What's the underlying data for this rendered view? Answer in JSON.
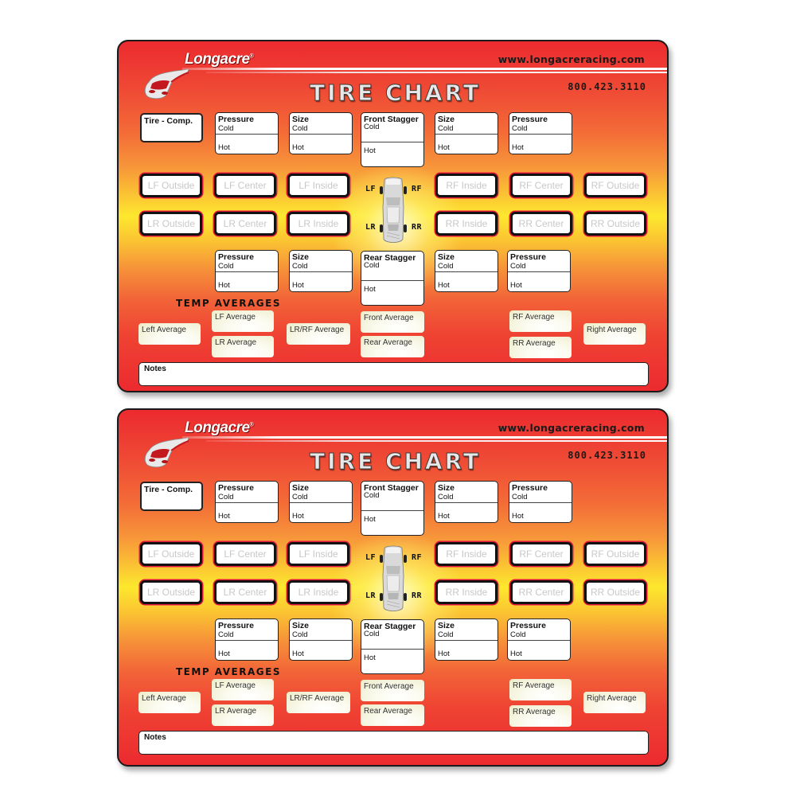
{
  "cards": [
    {
      "brand": "Longacre",
      "registered_mark": "®",
      "website": "www.longacreracing.com",
      "phone": "800.423.3110",
      "title": "TIRE CHART",
      "tire_comp_label": "Tire - Comp.",
      "front_row": {
        "left_pressure": {
          "label": "Pressure",
          "cold": "Cold",
          "hot": "Hot"
        },
        "left_size": {
          "label": "Size",
          "cold": "Cold",
          "hot": "Hot"
        },
        "stagger": {
          "label": "Front Stagger",
          "cold": "Cold",
          "hot": "Hot"
        },
        "right_size": {
          "label": "Size",
          "cold": "Cold",
          "hot": "Hot"
        },
        "right_pressure": {
          "label": "Pressure",
          "cold": "Cold",
          "hot": "Hot"
        }
      },
      "temp_front": [
        "LF Outside",
        "LF Center",
        "LF Inside",
        "RF Inside",
        "RF Center",
        "RF Outside"
      ],
      "temp_rear": [
        "LR Outside",
        "LR Center",
        "LR Inside",
        "RR Inside",
        "RR Center",
        "RR Outside"
      ],
      "wheel_labels": {
        "lf": "LF",
        "rf": "RF",
        "lr": "LR",
        "rr": "RR"
      },
      "rear_row": {
        "left_pressure": {
          "label": "Pressure",
          "cold": "Cold",
          "hot": "Hot"
        },
        "left_size": {
          "label": "Size",
          "cold": "Cold",
          "hot": "Hot"
        },
        "stagger": {
          "label": "Rear Stagger",
          "cold": "Cold",
          "hot": "Hot"
        },
        "right_size": {
          "label": "Size",
          "cold": "Cold",
          "hot": "Hot"
        },
        "right_pressure": {
          "label": "Pressure",
          "cold": "Cold",
          "hot": "Hot"
        }
      },
      "temp_averages_heading": "TEMP AVERAGES",
      "averages": {
        "left": "Left Average",
        "lf": "LF Average",
        "lr": "LR Average",
        "lr_rf": "LR/RF Average",
        "front": "Front Average",
        "rear": "Rear Average",
        "rf": "RF Average",
        "rr": "RR Average",
        "right": "Right Average"
      },
      "notes_label": "Notes"
    },
    {
      "brand": "Longacre",
      "registered_mark": "®",
      "website": "www.longacreracing.com",
      "phone": "800.423.3110",
      "title": "TIRE CHART",
      "tire_comp_label": "Tire - Comp.",
      "front_row": {
        "left_pressure": {
          "label": "Pressure",
          "cold": "Cold",
          "hot": "Hot"
        },
        "left_size": {
          "label": "Size",
          "cold": "Cold",
          "hot": "Hot"
        },
        "stagger": {
          "label": "Front Stagger",
          "cold": "Cold",
          "hot": "Hot"
        },
        "right_size": {
          "label": "Size",
          "cold": "Cold",
          "hot": "Hot"
        },
        "right_pressure": {
          "label": "Pressure",
          "cold": "Cold",
          "hot": "Hot"
        }
      },
      "temp_front": [
        "LF Outside",
        "LF Center",
        "LF Inside",
        "RF Inside",
        "RF Center",
        "RF Outside"
      ],
      "temp_rear": [
        "LR Outside",
        "LR Center",
        "LR Inside",
        "RR Inside",
        "RR Center",
        "RR Outside"
      ],
      "wheel_labels": {
        "lf": "LF",
        "rf": "RF",
        "lr": "LR",
        "rr": "RR"
      },
      "rear_row": {
        "left_pressure": {
          "label": "Pressure",
          "cold": "Cold",
          "hot": "Hot"
        },
        "left_size": {
          "label": "Size",
          "cold": "Cold",
          "hot": "Hot"
        },
        "stagger": {
          "label": "Rear Stagger",
          "cold": "Cold",
          "hot": "Hot"
        },
        "right_size": {
          "label": "Size",
          "cold": "Cold",
          "hot": "Hot"
        },
        "right_pressure": {
          "label": "Pressure",
          "cold": "Cold",
          "hot": "Hot"
        }
      },
      "temp_averages_heading": "TEMP AVERAGES",
      "averages": {
        "left": "Left Average",
        "lf": "LF Average",
        "lr": "LR Average",
        "lr_rf": "LR/RF Average",
        "front": "Front Average",
        "rear": "Rear Average",
        "rf": "RF Average",
        "rr": "RR Average",
        "right": "Right Average"
      },
      "notes_label": "Notes"
    }
  ],
  "colors": {
    "card_red": "#ec2a2f",
    "card_yellow": "#fde82e",
    "temp_box_outline": "#e4173b",
    "temp_placeholder_text": "#c8c8c8",
    "average_box_tint": "#ecebc8"
  }
}
